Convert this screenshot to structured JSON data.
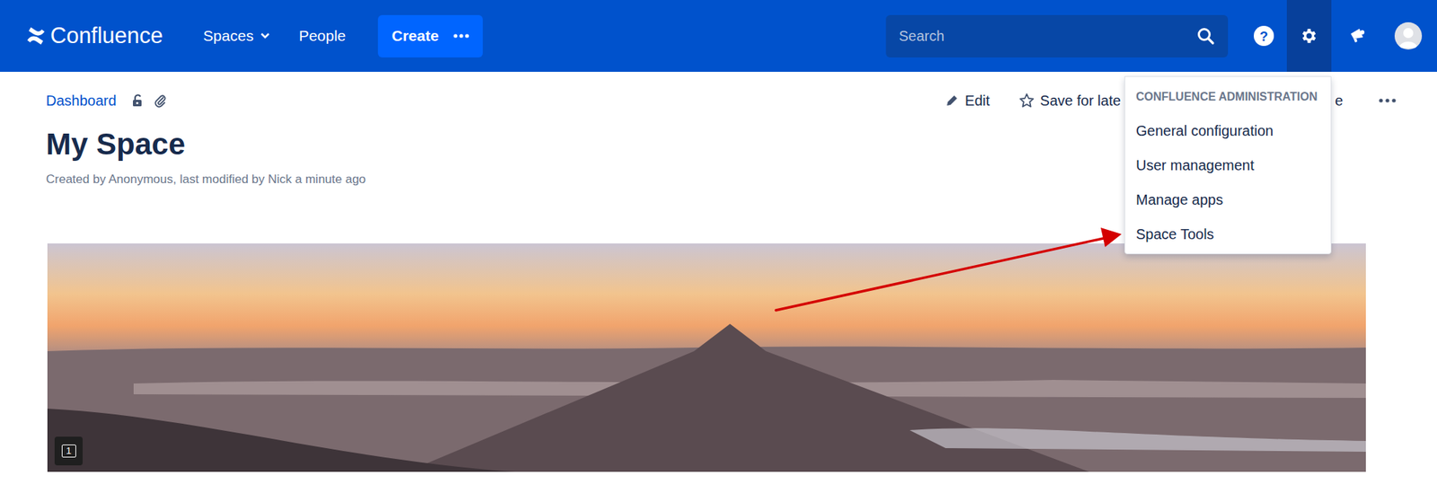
{
  "header": {
    "logo": "Confluence",
    "nav": [
      {
        "label": "Spaces",
        "dropdown": true
      },
      {
        "label": "People",
        "dropdown": false
      }
    ],
    "create": "Create",
    "search": {
      "placeholder": "Search"
    },
    "help_icon": "?",
    "settings": {
      "selected": true
    }
  },
  "breadcrumb": "Dashboard",
  "page": {
    "title": "My Space",
    "byline": "Created by Anonymous, last modified by Nick a minute ago",
    "comment_count": "1"
  },
  "actions": [
    "Edit",
    "Save for late",
    "e"
  ],
  "admin_menu": {
    "header": "CONFLUENCE ADMINISTRATION",
    "items": [
      "General configuration",
      "User management",
      "Manage apps",
      "Space Tools"
    ]
  }
}
